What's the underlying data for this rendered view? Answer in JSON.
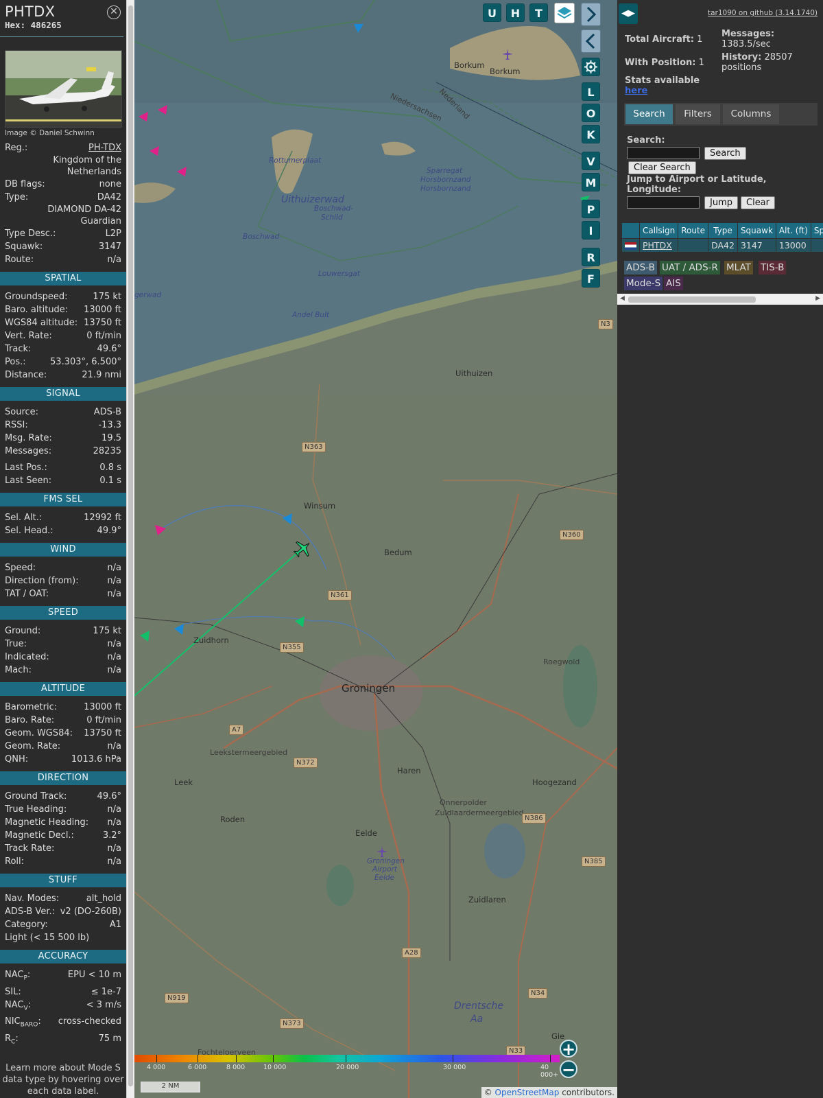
{
  "info": {
    "callsign": "PHTDX",
    "hex_label": "Hex:",
    "hex": "486265",
    "photo_credit": "Image © Daniel Schwinn",
    "general": [
      {
        "k": "Reg.:",
        "v": "PH-TDX"
      },
      {
        "k": "",
        "v": "Kingdom of the Netherlands"
      },
      {
        "k": "DB flags:",
        "v": "none"
      },
      {
        "k": "Type:",
        "v": "DA42"
      },
      {
        "k": "",
        "v": "DIAMOND DA-42 Guardian"
      },
      {
        "k": "Type Desc.:",
        "v": "L2P"
      },
      {
        "k": "Squawk:",
        "v": "3147"
      },
      {
        "k": "Route:",
        "v": "n/a"
      }
    ],
    "sections": {
      "spatial": "SPATIAL",
      "signal": "SIGNAL",
      "fms": "FMS SEL",
      "wind": "WIND",
      "speed": "SPEED",
      "altitude": "ALTITUDE",
      "direction": "DIRECTION",
      "stuff": "STUFF",
      "accuracy": "ACCURACY"
    },
    "spatial": [
      {
        "k": "Groundspeed:",
        "v": "175 kt"
      },
      {
        "k": "Baro. altitude:",
        "v": "13000 ft"
      },
      {
        "k": "WGS84 altitude:",
        "v": "13750 ft"
      },
      {
        "k": "Vert. Rate:",
        "v": "0 ft/min"
      },
      {
        "k": "Track:",
        "v": "49.6°"
      },
      {
        "k": "Pos.:",
        "v": "53.303°, 6.500°"
      },
      {
        "k": "Distance:",
        "v": "21.9 nmi"
      }
    ],
    "signal": [
      {
        "k": "Source:",
        "v": "ADS-B"
      },
      {
        "k": "RSSI:",
        "v": "-13.3"
      },
      {
        "k": "Msg. Rate:",
        "v": "19.5"
      },
      {
        "k": "Messages:",
        "v": "28235"
      }
    ],
    "signal2": [
      {
        "k": "Last Pos.:",
        "v": "0.8 s"
      },
      {
        "k": "Last Seen:",
        "v": "0.1 s"
      }
    ],
    "fms": [
      {
        "k": "Sel. Alt.:",
        "v": "12992 ft"
      },
      {
        "k": "Sel. Head.:",
        "v": "49.9°"
      }
    ],
    "wind": [
      {
        "k": "Speed:",
        "v": "n/a"
      },
      {
        "k": "Direction (from):",
        "v": "n/a"
      },
      {
        "k": "TAT / OAT:",
        "v": "n/a"
      }
    ],
    "speed": [
      {
        "k": "Ground:",
        "v": "175 kt"
      },
      {
        "k": "True:",
        "v": "n/a"
      },
      {
        "k": "Indicated:",
        "v": "n/a"
      },
      {
        "k": "Mach:",
        "v": "n/a"
      }
    ],
    "altitude": [
      {
        "k": "Barometric:",
        "v": "13000 ft"
      },
      {
        "k": "Baro. Rate:",
        "v": "0 ft/min"
      },
      {
        "k": "Geom. WGS84:",
        "v": "13750 ft"
      },
      {
        "k": "Geom. Rate:",
        "v": "n/a"
      },
      {
        "k": "QNH:",
        "v": "1013.6 hPa"
      }
    ],
    "direction": [
      {
        "k": "Ground Track:",
        "v": "49.6°"
      },
      {
        "k": "True Heading:",
        "v": "n/a"
      },
      {
        "k": "Magnetic Heading:",
        "v": "n/a"
      },
      {
        "k": "Magnetic Decl.:",
        "v": "3.2°"
      },
      {
        "k": "Track Rate:",
        "v": "n/a"
      },
      {
        "k": "Roll:",
        "v": "n/a"
      }
    ],
    "stuff": [
      {
        "k": "Nav. Modes:",
        "v": "alt_hold"
      },
      {
        "k": "ADS-B Ver.:",
        "v": "v2 (DO-260B)"
      },
      {
        "k": "Category:",
        "v": "A1"
      }
    ],
    "stuff_category_desc": "Light (< 15 500 lb)",
    "accuracy": [
      {
        "k": "NAC",
        "sub": "P",
        "v": "EPU < 10 m"
      },
      {
        "k": "SIL:",
        "sub": "",
        "v": "≤ 1e-7"
      },
      {
        "k": "NAC",
        "sub": "V",
        "v": "< 3 m/s"
      },
      {
        "k": "NIC",
        "sub": "BARO",
        "v": "cross-checked"
      },
      {
        "k": "R",
        "sub": "C",
        "v": "75 m"
      }
    ],
    "note": "Learn more about Mode S data type by hovering over each data label."
  },
  "map": {
    "top_buttons": [
      "U",
      "H",
      "T"
    ],
    "side_buttons": [
      "L",
      "O",
      "K",
      "V",
      "M",
      "P",
      "I",
      "R",
      "F"
    ],
    "labels": [
      {
        "t": "Borkum",
        "c": "town"
      },
      {
        "t": "Borkum",
        "c": "town"
      },
      {
        "t": "Niedersachsen",
        "c": ""
      },
      {
        "t": "Nederland",
        "c": ""
      },
      {
        "t": "Rottumerplaat",
        "c": "water"
      },
      {
        "t": "Uithuizerwad",
        "c": "sea"
      },
      {
        "t": "Boschwad-",
        "c": "water"
      },
      {
        "t": "Schild",
        "c": "water"
      },
      {
        "t": "Sparregat",
        "c": "water"
      },
      {
        "t": "Horsbornzand",
        "c": "water"
      },
      {
        "t": "Horsbornzand",
        "c": "water"
      },
      {
        "t": "Boschwad",
        "c": "water"
      },
      {
        "t": "Louwersgat",
        "c": "water"
      },
      {
        "t": "gerwad",
        "c": "water"
      },
      {
        "t": "Andel Bult",
        "c": "water"
      },
      {
        "t": "Uithuizen",
        "c": "town"
      },
      {
        "t": "Winsum",
        "c": "town"
      },
      {
        "t": "Bedum",
        "c": "town"
      },
      {
        "t": "Zuidhorn",
        "c": "town"
      },
      {
        "t": "Groningen",
        "c": "city"
      },
      {
        "t": "Haren",
        "c": "town"
      },
      {
        "t": "Hoogezand",
        "c": "town"
      },
      {
        "t": "Leek",
        "c": "town"
      },
      {
        "t": "Roden",
        "c": "town"
      },
      {
        "t": "Eelde",
        "c": "town"
      },
      {
        "t": "Groningen",
        "c": "water"
      },
      {
        "t": "Airport",
        "c": "water"
      },
      {
        "t": "Eelde",
        "c": "water"
      },
      {
        "t": "Zuidlaren",
        "c": "town"
      },
      {
        "t": "Leekstermeergebied",
        "c": ""
      },
      {
        "t": "Onnerpolder",
        "c": ""
      },
      {
        "t": "Zuidlaardermeergebied",
        "c": ""
      },
      {
        "t": "Roegwold",
        "c": ""
      },
      {
        "t": "Drentsche",
        "c": "sea"
      },
      {
        "t": "Aa",
        "c": "sea"
      },
      {
        "t": "Fochteloerveen",
        "c": ""
      },
      {
        "t": "Gie",
        "c": "town"
      }
    ],
    "roads": [
      "N363",
      "N361",
      "N355",
      "N360",
      "A7",
      "N372",
      "N386",
      "N385",
      "A28",
      "N919",
      "N373",
      "N34",
      "N33",
      "N3"
    ],
    "alt_ticks": [
      "4 000",
      "6 000",
      "8 000",
      "10 000",
      "20 000",
      "30 000",
      "40 000+"
    ],
    "scale": "2 NM",
    "attribution_prefix": "© ",
    "attribution_link": "OpenStreetMap",
    "attribution_suffix": " contributors."
  },
  "right": {
    "version": "tar1090 on github (3.14.1740)",
    "total_label": "Total Aircraft:",
    "total": "1",
    "position_label": "With Position:",
    "position": "1",
    "stats_label": "Stats available",
    "stats_link": "here",
    "messages_label": "Messages:",
    "messages": "1383.5/sec",
    "history_label": "History:",
    "history": "28507 positions",
    "tabs": [
      "Search",
      "Filters",
      "Columns"
    ],
    "search_label": "Search:",
    "search_btn": "Search",
    "clear_search_btn": "Clear Search",
    "jump_label": "Jump to Airport or Latitude, Longitude:",
    "jump_btn": "Jump",
    "clear_btn": "Clear",
    "columns": [
      "Callsign",
      "Route",
      "Type",
      "Squawk",
      "Alt. (ft)",
      "Spd."
    ],
    "rows": [
      {
        "callsign": "PHTDX",
        "route": "",
        "type": "DA42",
        "squawk": "3147",
        "alt": "13000",
        "spd": ""
      }
    ],
    "legend": [
      {
        "t": "ADS-B",
        "bg": "#3d5a6e"
      },
      {
        "t": "UAT / ADS-R",
        "bg": "#2e5a3a"
      },
      {
        "t": "MLAT",
        "bg": "#5b4c2a"
      },
      {
        "t": "TIS-B",
        "bg": "#5a2a36"
      },
      {
        "t": "Mode-S",
        "bg": "#3c3a6a"
      },
      {
        "t": "AIS",
        "bg": "#4a2a4a"
      }
    ]
  }
}
